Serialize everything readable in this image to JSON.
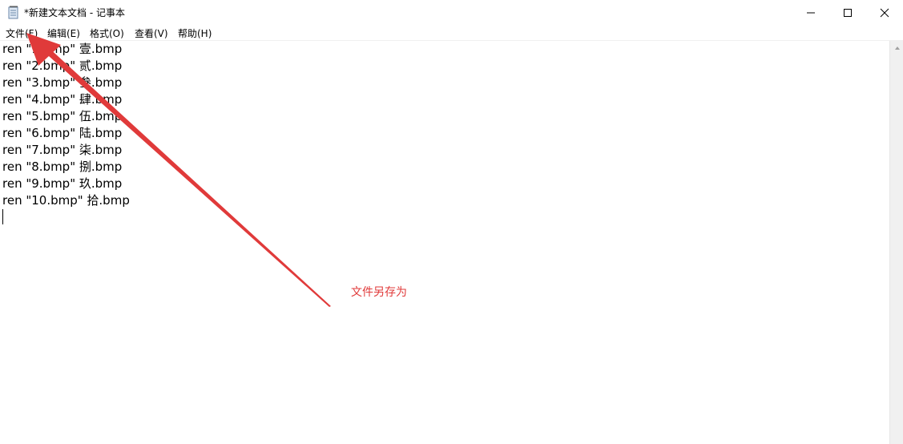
{
  "window": {
    "title": "*新建文本文档 - 记事本"
  },
  "menu": {
    "items": [
      {
        "label": "文件(F)"
      },
      {
        "label": "编辑(E)"
      },
      {
        "label": "格式(O)"
      },
      {
        "label": "查看(V)"
      },
      {
        "label": "帮助(H)"
      }
    ]
  },
  "editor": {
    "lines": [
      "ren \"1.bmp\" 壹.bmp",
      "ren \"2.bmp\" 贰.bmp",
      "ren \"3.bmp\" 叁.bmp",
      "ren \"4.bmp\" 肆.bmp",
      "ren \"5.bmp\" 伍.bmp",
      "ren \"6.bmp\" 陆.bmp",
      "ren \"7.bmp\" 柒.bmp",
      "ren \"8.bmp\" 捌.bmp",
      "ren \"9.bmp\" 玖.bmp",
      "ren \"10.bmp\" 拾.bmp"
    ]
  },
  "annotation": {
    "text": "文件另存为",
    "color": "#e03a3a"
  }
}
